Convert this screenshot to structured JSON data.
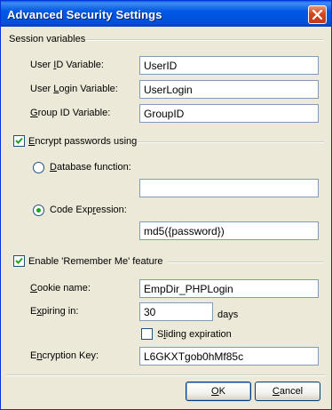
{
  "window": {
    "title": "Advanced Security Settings"
  },
  "session": {
    "heading": "Session variables",
    "user_id_label_pre": "User ",
    "user_id_label_u": "I",
    "user_id_label_post": "D Variable:",
    "user_id_value": "UserID",
    "user_login_label_pre": "User ",
    "user_login_label_u": "L",
    "user_login_label_post": "ogin Variable:",
    "user_login_value": "UserLogin",
    "group_id_label_pre": "",
    "group_id_label_u": "G",
    "group_id_label_post": "roup ID Variable:",
    "group_id_value": "GroupID"
  },
  "encrypt": {
    "label_pre": "",
    "label_u": "E",
    "label_post": "ncrypt passwords using",
    "checked": true,
    "db_function_label_pre": "",
    "db_function_label_u": "D",
    "db_function_label_post": "atabase function:",
    "db_function_value": "",
    "code_expr_label_pre": "Code Exp",
    "code_expr_label_u": "r",
    "code_expr_label_post": "ession:",
    "code_expr_value": "md5({password})",
    "selected": "code_expression"
  },
  "remember": {
    "label_pre": "Enable 'Remember Me' feature",
    "checked": true,
    "cookie_label_pre": "",
    "cookie_label_u": "C",
    "cookie_label_post": "ookie name:",
    "cookie_value": "EmpDir_PHPLogin",
    "expiring_label_pre": "E",
    "expiring_label_u": "x",
    "expiring_label_post": "piring in:",
    "expiring_value": "30",
    "days_label": "days",
    "sliding_label_pre": "S",
    "sliding_label_u": "l",
    "sliding_label_post": "iding expiration",
    "sliding_checked": false,
    "key_label_pre": "E",
    "key_label_u": "n",
    "key_label_post": "cryption Key:",
    "key_value": "L6GKXTgob0hMf85c"
  },
  "buttons": {
    "ok_u": "O",
    "ok_post": "K",
    "cancel_u": "C",
    "cancel_post": "ancel"
  },
  "colors": {
    "accent": "#0054e3",
    "radio_dot": "#21a121",
    "check": "#21a121"
  }
}
